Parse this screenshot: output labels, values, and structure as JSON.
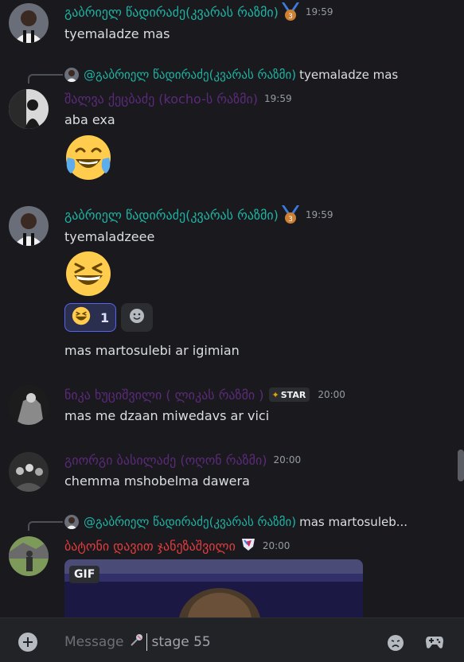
{
  "messages": [
    {
      "author": "გაბრიელ წადირაძე(კვარას რაზმი)",
      "author_color": "#1eb3a3",
      "badge_icon": "bronze-medal-icon",
      "time": "19:59",
      "text": "tyemaladze mas"
    },
    {
      "reply_to_author": "@გაბრიელ წადირაძე(კვარას რაზმი)",
      "reply_to_text": "tyemaladze mas",
      "author": "შალვა ქეცბაძე (kocho-ს რაზმი)",
      "author_color": "#5b2a7a",
      "time": "19:59",
      "text": "aba exa",
      "emoji": "joy-emoji"
    },
    {
      "author": "გაბრიელ წადირაძე(კვარას რაზმი)",
      "author_color": "#1eb3a3",
      "badge_icon": "bronze-medal-icon",
      "time": "19:59",
      "text": "tyemaladzeee",
      "emoji": "laughing-emoji",
      "reaction": {
        "emoji": "laughing-emoji",
        "count": "1"
      },
      "text2": "mas martosulebi ar igimian"
    },
    {
      "author": "ნიკა ხუციშვილი ( ლიკას რაზმი )",
      "author_color": "#5b2a7a",
      "star_badge": "STAR",
      "time": "20:00",
      "text": "mas me dzaan miwedavs ar vici"
    },
    {
      "author": "გიორგი ბასილაძე (ოღონ რაზმი)",
      "author_color": "#5b2a7a",
      "time": "20:00",
      "text": "chemma mshobelma dawera"
    },
    {
      "reply_to_author": "@გაბრიელ წადირაძე(კვარას რაზმი)",
      "reply_to_text": "mas martosuleb...",
      "author": "ბატონი დავით ჯანეზაშვილი",
      "author_color": "#e03c3c",
      "badge_icon": "shield-badge-icon",
      "time": "20:00",
      "gif_label": "GIF"
    }
  ],
  "composer": {
    "placeholder": "Message",
    "typed_text": "stage 55"
  }
}
